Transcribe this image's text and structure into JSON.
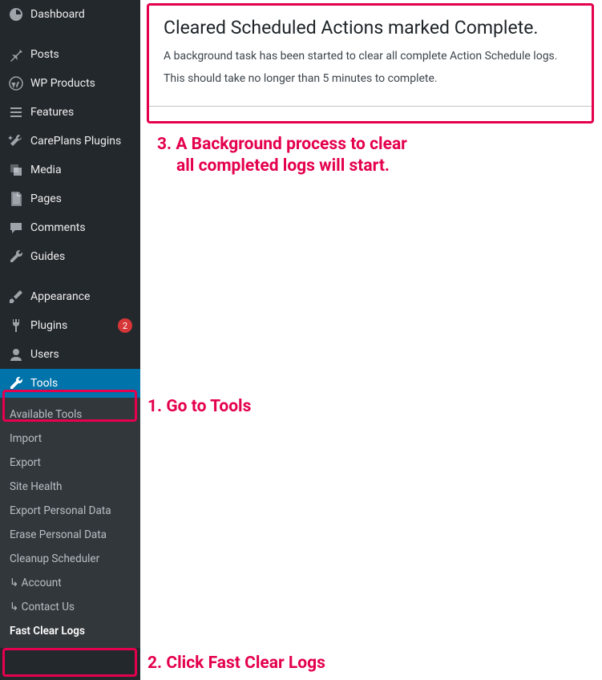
{
  "sidebar": {
    "items": [
      {
        "label": "Dashboard",
        "icon": "dashboard"
      },
      {
        "label": "Posts",
        "icon": "pin"
      },
      {
        "label": "WP Products",
        "icon": "wp"
      },
      {
        "label": "Features",
        "icon": "list"
      },
      {
        "label": "CarePlans Plugins",
        "icon": "wrench-spark"
      },
      {
        "label": "Media",
        "icon": "media"
      },
      {
        "label": "Pages",
        "icon": "page"
      },
      {
        "label": "Comments",
        "icon": "comment"
      },
      {
        "label": "Guides",
        "icon": "wrench"
      },
      {
        "label": "Appearance",
        "icon": "brush"
      },
      {
        "label": "Plugins",
        "icon": "plug",
        "badge": "2"
      },
      {
        "label": "Users",
        "icon": "user"
      },
      {
        "label": "Tools",
        "icon": "wrench"
      }
    ],
    "submenu": [
      "Available Tools",
      "Import",
      "Export",
      "Site Health",
      "Export Personal Data",
      "Erase Personal Data",
      "Cleanup Scheduler",
      "↳ Account",
      "↳ Contact Us",
      "Fast Clear Logs"
    ]
  },
  "notice": {
    "title": "Cleared Scheduled Actions marked Complete.",
    "line1": "A background task has been started to clear all complete Action Schedule logs.",
    "line2": "This should take no longer than 5 minutes to complete."
  },
  "annotations": {
    "a1": "1. Go to Tools",
    "a2": "2. Click Fast Clear Logs",
    "a3a": "3. A Background process to clear",
    "a3b": "all completed logs will start."
  }
}
